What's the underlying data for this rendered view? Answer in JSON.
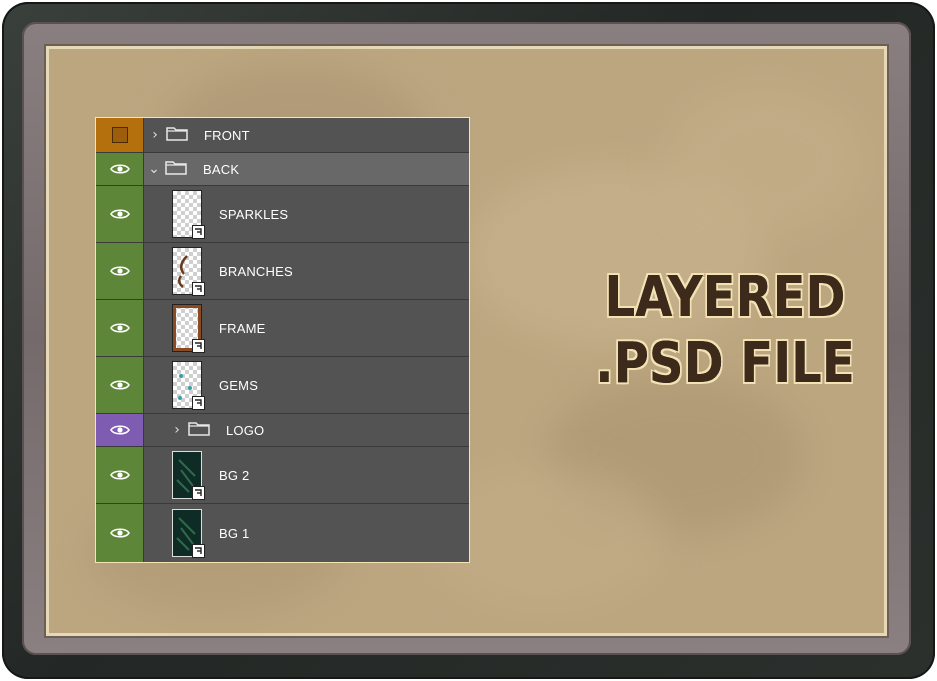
{
  "layers_panel": {
    "layers": [
      {
        "name": "FRONT",
        "kind": "group",
        "expanded": false,
        "visibility": "square",
        "color_tag": "orange"
      },
      {
        "name": "BACK",
        "kind": "group",
        "expanded": true,
        "visibility": "eye",
        "color_tag": "green"
      },
      {
        "name": "SPARKLES",
        "kind": "smart-object",
        "visibility": "eye",
        "color_tag": "green"
      },
      {
        "name": "BRANCHES",
        "kind": "smart-object",
        "visibility": "eye",
        "color_tag": "green"
      },
      {
        "name": "FRAME",
        "kind": "smart-object",
        "visibility": "eye",
        "color_tag": "green"
      },
      {
        "name": "GEMS",
        "kind": "smart-object",
        "visibility": "eye",
        "color_tag": "green"
      },
      {
        "name": "LOGO",
        "kind": "group",
        "expanded": false,
        "visibility": "eye",
        "color_tag": "purple"
      },
      {
        "name": "BG 2",
        "kind": "smart-object",
        "visibility": "eye",
        "color_tag": "green"
      },
      {
        "name": "BG 1",
        "kind": "smart-object",
        "visibility": "eye",
        "color_tag": "green"
      }
    ]
  },
  "promo": {
    "line1": "LAYERED",
    "line2": ".PSD FILE"
  },
  "colors": {
    "tag_green": "#5d8638",
    "tag_orange": "#b5700e",
    "tag_purple": "#7e5cb1",
    "panel_bg": "#535353",
    "canvas_bg": "#bca680",
    "promo_text": "#3d2a1b"
  }
}
